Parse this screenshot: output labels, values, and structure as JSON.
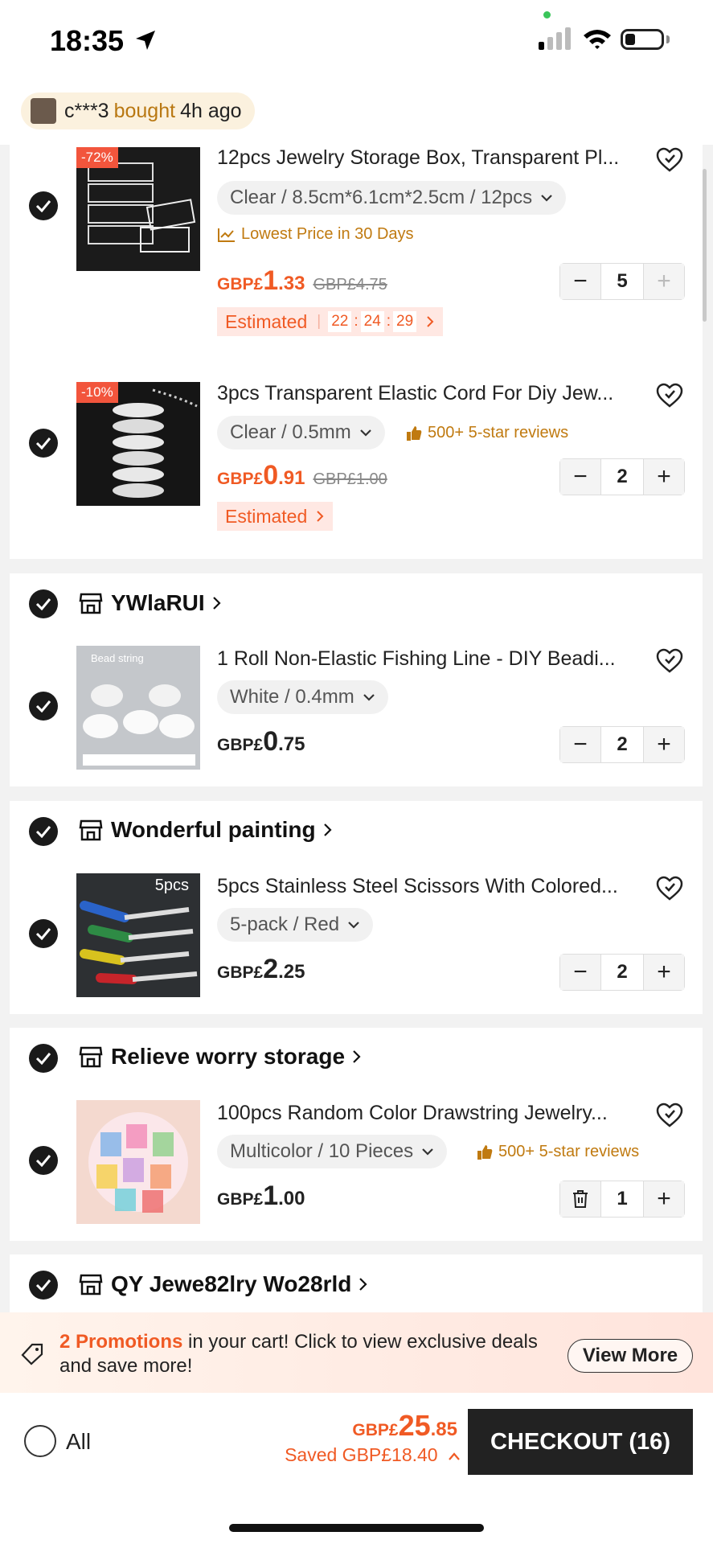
{
  "status_bar": {
    "time": "18:35"
  },
  "bought_banner": {
    "user": "c***3",
    "verb": "bought",
    "ago": "4h ago"
  },
  "items": [
    {
      "title": "12pcs Jewelry Storage Box, Transparent Pl...",
      "discount": "-72%",
      "variant": "Clear / 8.5cm*6.1cm*2.5cm / 12pcs",
      "tag": "Lowest Price in 30 Days",
      "currency": "GBP£",
      "price_int": "1",
      "price_dec": ".33",
      "old_price": "GBP£4.75",
      "qty": "5",
      "estimated": "Estimated",
      "countdown": [
        "22",
        "24",
        "29"
      ]
    },
    {
      "title": "3pcs Transparent Elastic Cord For Diy Jew...",
      "discount": "-10%",
      "variant": "Clear / 0.5mm",
      "reviews": "500+ 5-star reviews",
      "currency": "GBP£",
      "price_int": "0",
      "price_dec": ".91",
      "old_price": "GBP£1.00",
      "qty": "2",
      "estimated": "Estimated"
    },
    {
      "store": "YWlaRUI",
      "title": "1 Roll Non-Elastic Fishing Line - DIY Beadi...",
      "thumb_label": "Bead string",
      "variant": "White / 0.4mm",
      "currency": "GBP£",
      "price_int": "0",
      "price_dec": ".75",
      "qty": "2"
    },
    {
      "store": "Wonderful painting",
      "title": "5pcs Stainless Steel Scissors With Colored...",
      "thumb_label": "5pcs",
      "variant": "5-pack / Red",
      "currency": "GBP£",
      "price_int": "2",
      "price_dec": ".25",
      "qty": "2"
    },
    {
      "store": "Relieve worry storage",
      "title": "100pcs Random Color Drawstring Jewelry...",
      "variant": "Multicolor / 10 Pieces",
      "reviews": "500+ 5-star reviews",
      "currency": "GBP£",
      "price_int": "1",
      "price_dec": ".00",
      "qty": "1"
    }
  ],
  "next_store": "QY Jewe82lry Wo28rld",
  "promo": {
    "highlight": "2 Promotions",
    "text": " in your cart! Click to view exclusive deals and save more!",
    "button": "View More"
  },
  "bottom": {
    "all_label": "All",
    "currency": "GBP£",
    "total_int": "25",
    "total_dec": ".85",
    "saved": "Saved GBP£18.40",
    "checkout": "CHECKOUT (16)"
  },
  "colors": {
    "accent": "#f05a24",
    "gold": "#c07a10",
    "dark": "#222222"
  }
}
